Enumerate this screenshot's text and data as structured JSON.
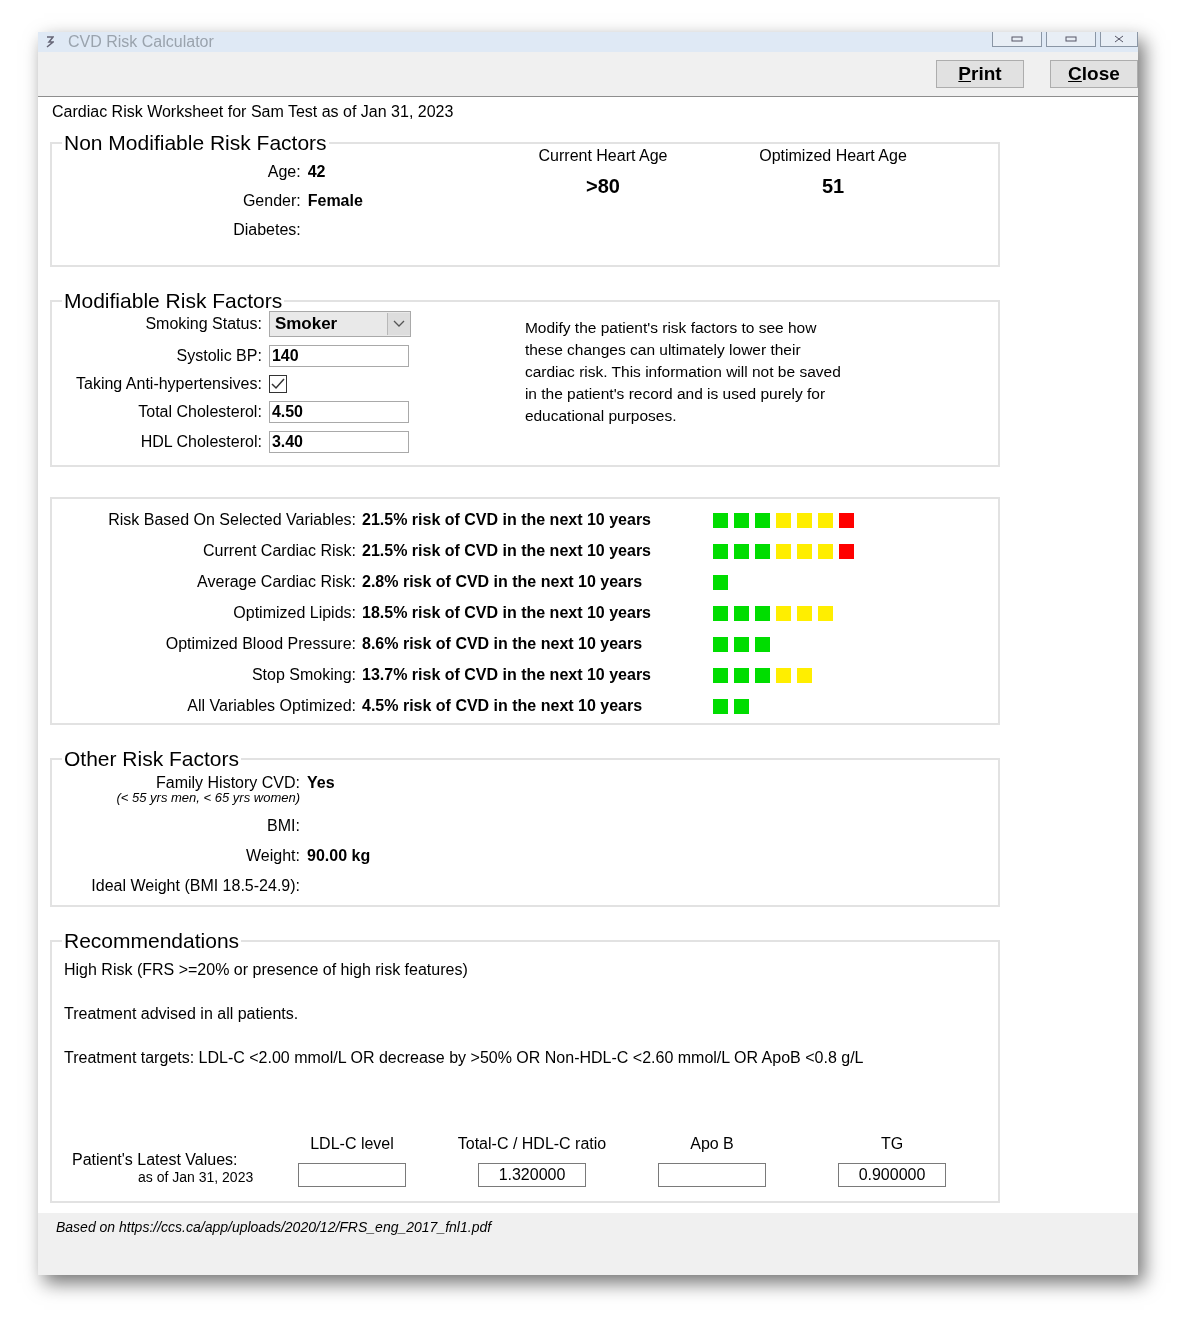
{
  "window": {
    "title": "CVD Risk Calculator"
  },
  "toolbar": {
    "buttons": [
      "Print",
      "Close"
    ]
  },
  "worksheet_title": "Cardiac Risk Worksheet for Sam Test as of Jan 31, 2023",
  "non_modifiable": {
    "legend": "Non Modifiable Risk Factors",
    "fields": [
      {
        "label": "Age:",
        "value": "42"
      },
      {
        "label": "Gender:",
        "value": "Female"
      },
      {
        "label": "Diabetes:"
      }
    ],
    "heart_ages": [
      {
        "label": "Current Heart Age",
        "value": ">80"
      },
      {
        "label": "Optimized Heart Age",
        "value": "51"
      }
    ]
  },
  "modifiable": {
    "legend": "Modifiable Risk Factors",
    "fields": [
      {
        "kind": "dropdown",
        "label": "Smoking Status:",
        "value": "Smoker"
      },
      {
        "kind": "text",
        "label": "Systolic BP:",
        "value": "140"
      },
      {
        "kind": "checkbox",
        "label": "Taking Anti-hypertensives:",
        "checked": true
      },
      {
        "kind": "text",
        "label": "Total Cholesterol:",
        "value": "4.50"
      },
      {
        "kind": "text",
        "label": "HDL Cholesterol:",
        "value": "3.40"
      }
    ],
    "note": "Modify the patient's risk factors to see how these changes can ultimately lower their cardiac risk. This information will not be saved in the patient's record and is used purely for educational purposes."
  },
  "risks": [
    {
      "label": "Risk Based On Selected Variables:",
      "value": "21.5% risk of CVD in the next 10 years",
      "blocks": [
        {
          "color": "#00dd00"
        },
        {
          "color": "#00dd00"
        },
        {
          "color": "#00dd00"
        },
        {
          "color": "#ffee00"
        },
        {
          "color": "#ffee00"
        },
        {
          "color": "#ffee00"
        },
        {
          "color": "#ff0000"
        }
      ]
    },
    {
      "label": "Current Cardiac Risk:",
      "value": "21.5% risk of CVD in the next 10 years",
      "blocks": [
        {
          "color": "#00dd00"
        },
        {
          "color": "#00dd00"
        },
        {
          "color": "#00dd00"
        },
        {
          "color": "#ffee00"
        },
        {
          "color": "#ffee00"
        },
        {
          "color": "#ffee00"
        },
        {
          "color": "#ff0000"
        }
      ]
    },
    {
      "label": "Average Cardiac Risk:",
      "value": "2.8% risk of CVD in the next 10 years",
      "blocks": [
        {
          "color": "#00dd00"
        }
      ]
    },
    {
      "label": "Optimized Lipids:",
      "value": "18.5% risk of CVD in the next 10 years",
      "blocks": [
        {
          "color": "#00dd00"
        },
        {
          "color": "#00dd00"
        },
        {
          "color": "#00dd00"
        },
        {
          "color": "#ffee00"
        },
        {
          "color": "#ffee00"
        },
        {
          "color": "#ffee00"
        }
      ]
    },
    {
      "label": "Optimized Blood Pressure:",
      "value": "8.6% risk of CVD in the next 10 years",
      "blocks": [
        {
          "color": "#00dd00"
        },
        {
          "color": "#00dd00"
        },
        {
          "color": "#00dd00"
        }
      ]
    },
    {
      "label": "Stop Smoking:",
      "value": "13.7% risk of CVD in the next 10 years",
      "blocks": [
        {
          "color": "#00dd00"
        },
        {
          "color": "#00dd00"
        },
        {
          "color": "#00dd00"
        },
        {
          "color": "#ffee00"
        },
        {
          "color": "#ffee00"
        }
      ]
    },
    {
      "label": "All Variables Optimized:",
      "value": "4.5% risk of CVD in the next 10 years",
      "blocks": [
        {
          "color": "#00dd00"
        },
        {
          "color": "#00dd00"
        }
      ]
    }
  ],
  "other": {
    "legend": "Other Risk Factors",
    "fields": [
      {
        "label": "Family History CVD:",
        "note": "(< 55 yrs men, < 65 yrs women)",
        "value": "Yes"
      },
      {
        "label": "BMI:"
      },
      {
        "label": "Weight:",
        "value": "90.00 kg"
      },
      {
        "label": "Ideal Weight (BMI 18.5-24.9):"
      }
    ]
  },
  "recommendations": {
    "legend": "Recommendations",
    "paragraphs": [
      "High Risk (FRS >=20% or presence of high risk features)",
      "Treatment advised in all patients.",
      "Treatment targets: LDL-C <2.00 mmol/L OR decrease by >50% OR Non-HDL-C <2.60 mmol/L OR ApoB <0.8 g/L"
    ],
    "latest_label": "Patient's Latest Values:",
    "latest_date": "as of Jan 31, 2023",
    "columns": [
      {
        "label": "LDL-C level"
      },
      {
        "label": "Total-C / HDL-C ratio",
        "value": "1.320000"
      },
      {
        "label": "Apo B"
      },
      {
        "label": "TG",
        "value": "0.900000"
      }
    ]
  },
  "footer": "Based on https://ccs.ca/app/uploads/2020/12/FRS_eng_2017_fnl1.pdf"
}
